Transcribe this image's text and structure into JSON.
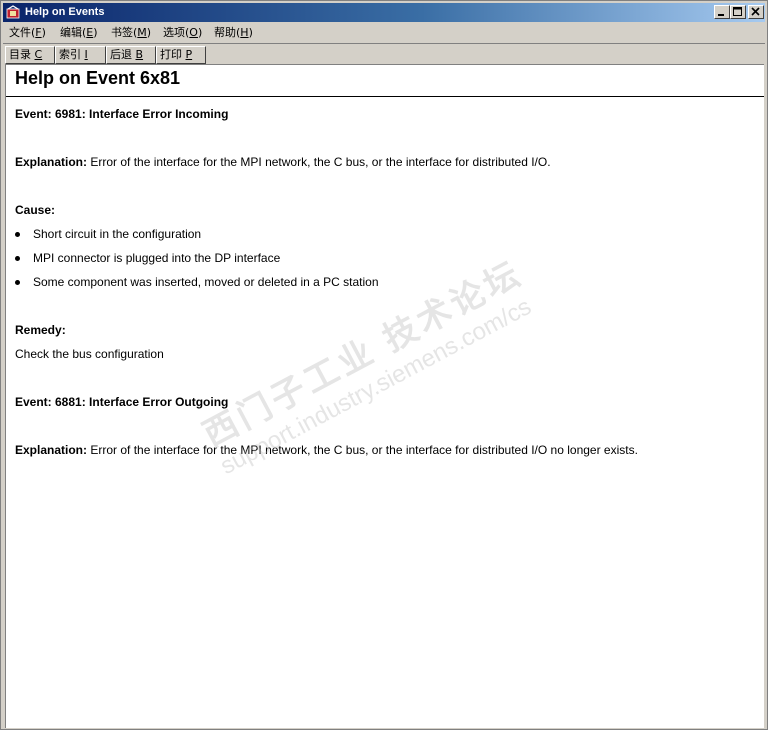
{
  "window": {
    "title": "Help on Events"
  },
  "menu": [
    {
      "label": "文件(",
      "key": "F",
      "tail": ")"
    },
    {
      "label": "编辑(",
      "key": "E",
      "tail": ")"
    },
    {
      "label": "书签(",
      "key": "M",
      "tail": ")"
    },
    {
      "label": "选项(",
      "key": "O",
      "tail": ")"
    },
    {
      "label": "帮助(",
      "key": "H",
      "tail": ")"
    }
  ],
  "toolbar": [
    {
      "label": "目录 ",
      "key": "C"
    },
    {
      "label": "索引 ",
      "key": "I"
    },
    {
      "label": "后退 ",
      "key": "B"
    },
    {
      "label": "打印 ",
      "key": "P"
    }
  ],
  "page": {
    "title": "Help on Event 6x81",
    "event1": {
      "heading": "Event: 6981: Interface Error Incoming",
      "explanation_label": "Explanation:",
      "explanation_text": " Error of the interface for the MPI network, the C bus, or the interface for distributed I/O."
    },
    "cause": {
      "heading": "Cause:",
      "items": [
        "Short circuit in the configuration",
        "MPI connector is plugged into the DP interface",
        "Some component was inserted, moved or deleted in a PC station"
      ]
    },
    "remedy": {
      "heading": "Remedy:",
      "text": "Check the bus configuration"
    },
    "event2": {
      "heading": "Event: 6881: Interface Error Outgoing",
      "explanation_label": "Explanation:",
      "explanation_text": " Error of the interface for the MPI network, the C bus, or the interface for distributed I/O no longer exists."
    }
  },
  "watermark": {
    "line1": "西门子工业 技术论坛",
    "line2": "support.industry.siemens.com/cs"
  }
}
